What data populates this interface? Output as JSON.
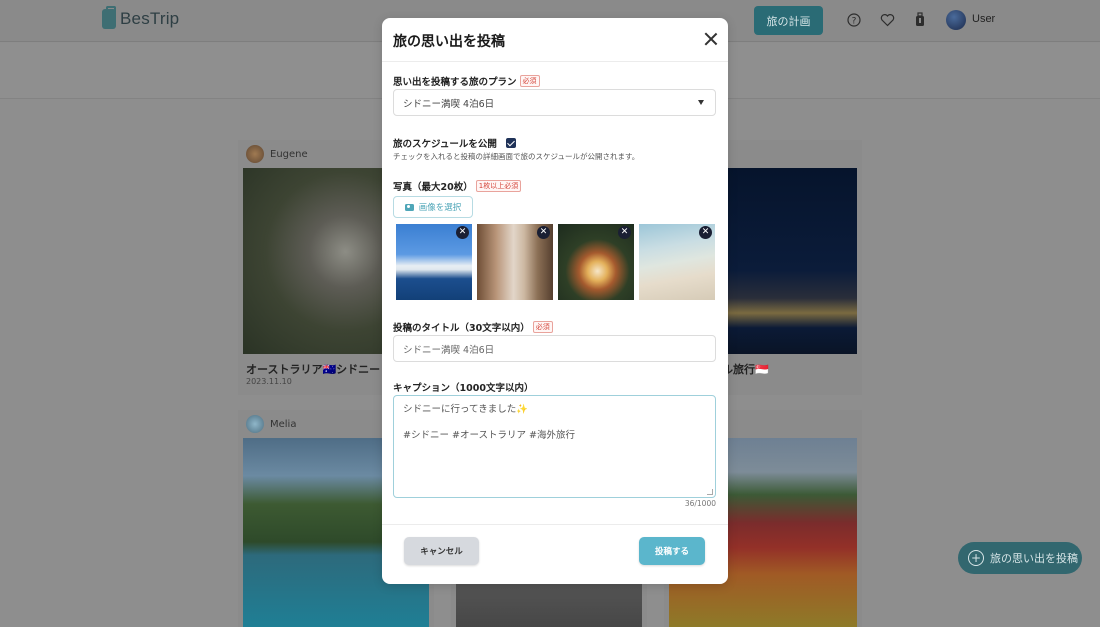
{
  "header": {
    "logo_text": "BesTrip",
    "plan_button": "旅の計画",
    "user_name": "User",
    "icons": [
      "help-icon",
      "heart-icon",
      "bookmark-icon"
    ]
  },
  "cards": [
    {
      "user": "Eugene",
      "title": "オーストラリア🇦🇺シドニー",
      "date": "2023.11.10"
    },
    {
      "title": "ル旅行🇸🇬"
    },
    {
      "user": "Melia"
    }
  ],
  "fab": {
    "label": "旅の思い出を投稿"
  },
  "modal": {
    "title": "旅の思い出を投稿",
    "plan_label": "思い出を投稿する旅のプラン",
    "required": "必須",
    "plan_value": "シドニー満喫 4泊6日",
    "publish_label": "旅のスケジュールを公開",
    "publish_checked": true,
    "publish_hint": "チェックを入れると投稿の詳細画面で旅のスケジュールが公開されます。",
    "photo_label": "写真（最大20枚）",
    "photo_required": "1枚以上必須",
    "upload_button": "画像を選択",
    "photos": [
      "opera-house-photo",
      "street-photo",
      "food-photo",
      "beach-photo"
    ],
    "title_label": "投稿のタイトル（30文字以内）",
    "title_value": "シドニー満喫 4泊6日",
    "caption_label": "キャプション（1000文字以内）",
    "caption_line1": "シドニーに行ってきました✨",
    "caption_line2": "#シドニー #オーストラリア  #海外旅行",
    "char_count": "36/1000",
    "cancel_button": "キャンセル",
    "submit_button": "投稿する"
  }
}
